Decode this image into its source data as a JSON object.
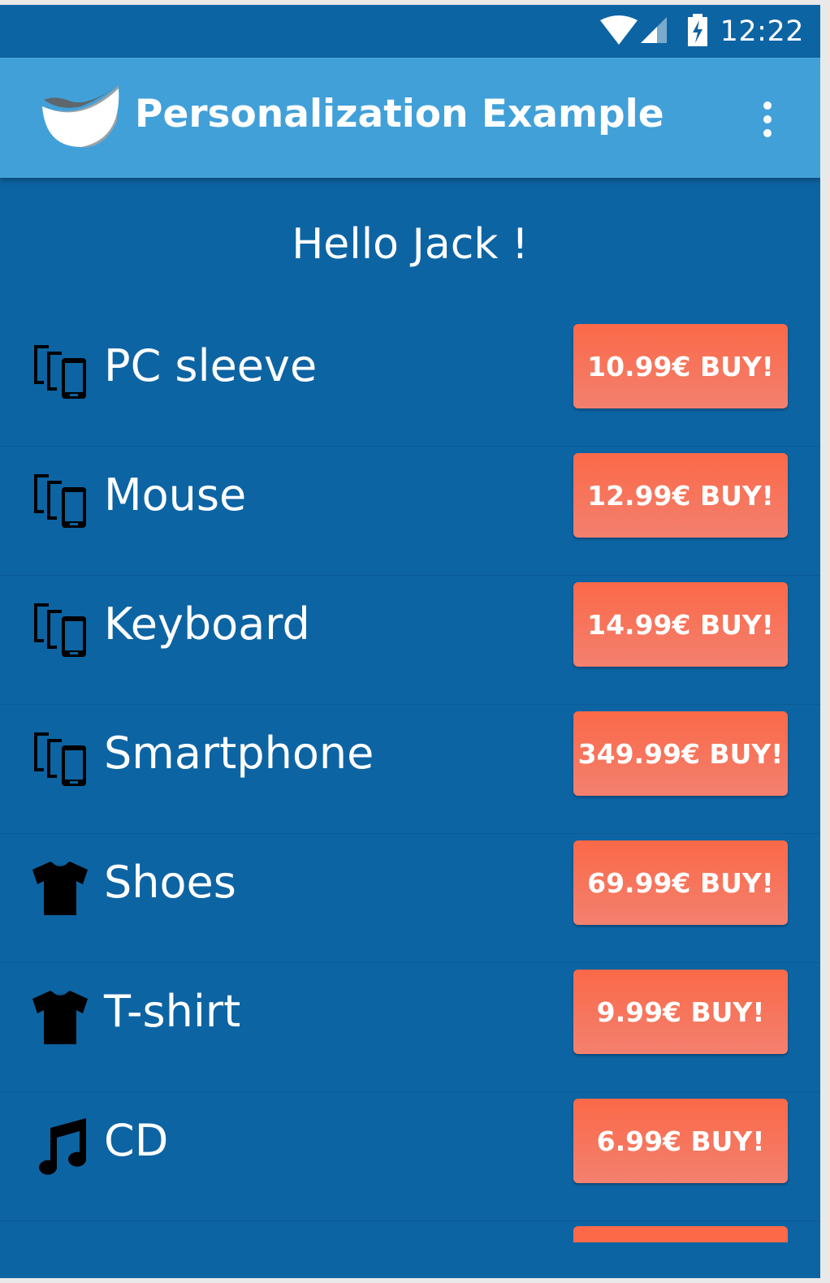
{
  "status_bar": {
    "time": "12:22",
    "icons": [
      "wifi-icon",
      "cell-signal-icon",
      "battery-charging-icon"
    ]
  },
  "app_bar": {
    "title": "Personalization Example",
    "logo_icon": "bowl-logo-icon",
    "menu_icon": "overflow-menu-icon"
  },
  "greeting": "Hello Jack !",
  "colors": {
    "status_bar": "#0d64a3",
    "app_bar": "#42a0d8",
    "background": "#0d64a3",
    "buy_button": "#fb6948"
  },
  "products": [
    {
      "name": "PC sleeve",
      "button": "10.99€ BUY!",
      "icon": "devices-icon"
    },
    {
      "name": "Mouse",
      "button": "12.99€ BUY!",
      "icon": "devices-icon"
    },
    {
      "name": "Keyboard",
      "button": "14.99€ BUY!",
      "icon": "devices-icon"
    },
    {
      "name": "Smartphone",
      "button": "349.99€ BUY!",
      "icon": "devices-icon"
    },
    {
      "name": "Shoes",
      "button": "69.99€ BUY!",
      "icon": "tshirt-icon"
    },
    {
      "name": "T-shirt",
      "button": "9.99€ BUY!",
      "icon": "tshirt-icon"
    },
    {
      "name": "CD",
      "button": "6.99€ BUY!",
      "icon": "music-note-icon"
    }
  ]
}
